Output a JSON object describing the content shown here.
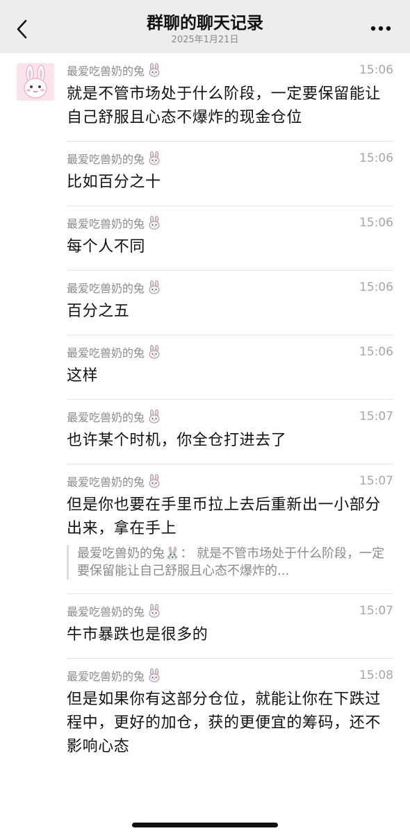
{
  "header": {
    "title": "群聊的聊天记录",
    "subtitle": "2025年1月21日"
  },
  "icons": {
    "back": "chevron-left-icon",
    "more": "more-dots-icon",
    "sender_badge": "bunny-face-icon"
  },
  "messages": [
    {
      "sender": "最爱吃兽奶的兔",
      "time": "15:06",
      "text": "就是不管市场处于什么阶段，一定要保留能让自己舒服且心态不爆炸的现金仓位",
      "show_avatar": true
    },
    {
      "sender": "最爱吃兽奶的兔",
      "time": "15:06",
      "text": "比如百分之十"
    },
    {
      "sender": "最爱吃兽奶的兔",
      "time": "15:06",
      "text": "每个人不同"
    },
    {
      "sender": "最爱吃兽奶的兔",
      "time": "15:06",
      "text": "百分之五"
    },
    {
      "sender": "最爱吃兽奶的兔",
      "time": "15:06",
      "text": "这样"
    },
    {
      "sender": "最爱吃兽奶的兔",
      "time": "15:07",
      "text": "也许某个时机，你全仓打进去了"
    },
    {
      "sender": "最爱吃兽奶的兔",
      "time": "15:07",
      "text": "但是你也要在手里币拉上去后重新出一小部分出来，拿在手上",
      "quote": "最爱吃兽奶的兔🐰： 就是不管市场处于什么阶段，一定要保留能让自己舒服且心态不爆炸的..."
    },
    {
      "sender": "最爱吃兽奶的兔",
      "time": "15:07",
      "text": "牛市暴跌也是很多的"
    },
    {
      "sender": "最爱吃兽奶的兔",
      "time": "15:08",
      "text": "但是如果你有这部分仓位，就能让你在下跌过程中，更好的加仓，获的更便宜的筹码，还不影响心态"
    }
  ]
}
